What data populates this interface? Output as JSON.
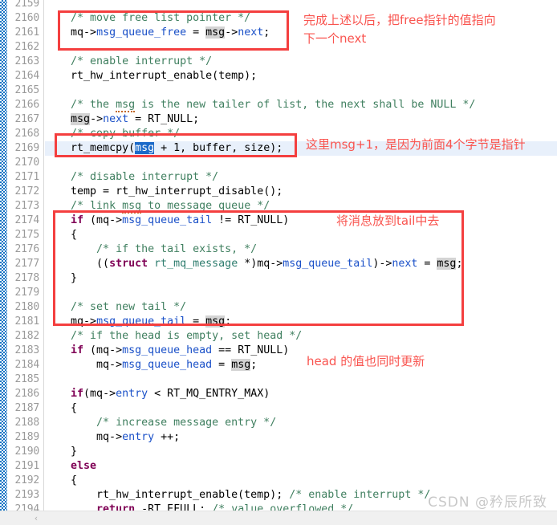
{
  "editor": {
    "first_visible_line": 2159,
    "line_height": 18,
    "highlighted_line": 2169,
    "gutter": {
      "line_numbers": [
        2159,
        2160,
        2161,
        2162,
        2163,
        2164,
        2165,
        2166,
        2167,
        2168,
        2169,
        2170,
        2171,
        2172,
        2173,
        2174,
        2175,
        2176,
        2177,
        2178,
        2179,
        2180,
        2181,
        2182,
        2183,
        2184,
        2185,
        2186,
        2187,
        2188,
        2189,
        2190,
        2191,
        2192,
        2193,
        2194
      ]
    },
    "code_lines": [
      {
        "n": 2159,
        "text": ""
      },
      {
        "n": 2160,
        "text": "    /* move free list pointer */"
      },
      {
        "n": 2161,
        "text": "    mq->msg_queue_free = msg->next;"
      },
      {
        "n": 2162,
        "text": ""
      },
      {
        "n": 2163,
        "text": "    /* enable interrupt */"
      },
      {
        "n": 2164,
        "text": "    rt_hw_interrupt_enable(temp);"
      },
      {
        "n": 2165,
        "text": ""
      },
      {
        "n": 2166,
        "text": "    /* the msg is the new tailer of list, the next shall be NULL */"
      },
      {
        "n": 2167,
        "text": "    msg->next = RT_NULL;"
      },
      {
        "n": 2168,
        "text": "    /* copy buffer */"
      },
      {
        "n": 2169,
        "text": "    rt_memcpy(msg + 1, buffer, size);"
      },
      {
        "n": 2170,
        "text": ""
      },
      {
        "n": 2171,
        "text": "    /* disable interrupt */"
      },
      {
        "n": 2172,
        "text": "    temp = rt_hw_interrupt_disable();"
      },
      {
        "n": 2173,
        "text": "    /* link msg to message queue */"
      },
      {
        "n": 2174,
        "text": "    if (mq->msg_queue_tail != RT_NULL)"
      },
      {
        "n": 2175,
        "text": "    {"
      },
      {
        "n": 2176,
        "text": "        /* if the tail exists, */"
      },
      {
        "n": 2177,
        "text": "        ((struct rt_mq_message *)mq->msg_queue_tail)->next = msg;"
      },
      {
        "n": 2178,
        "text": "    }"
      },
      {
        "n": 2179,
        "text": ""
      },
      {
        "n": 2180,
        "text": "    /* set new tail */"
      },
      {
        "n": 2181,
        "text": "    mq->msg_queue_tail = msg;"
      },
      {
        "n": 2182,
        "text": "    /* if the head is empty, set head */"
      },
      {
        "n": 2183,
        "text": "    if (mq->msg_queue_head == RT_NULL)"
      },
      {
        "n": 2184,
        "text": "        mq->msg_queue_head = msg;"
      },
      {
        "n": 2185,
        "text": ""
      },
      {
        "n": 2186,
        "text": "    if(mq->entry < RT_MQ_ENTRY_MAX)"
      },
      {
        "n": 2187,
        "text": "    {"
      },
      {
        "n": 2188,
        "text": "        /* increase message entry */"
      },
      {
        "n": 2189,
        "text": "        mq->entry ++;"
      },
      {
        "n": 2190,
        "text": "    }"
      },
      {
        "n": 2191,
        "text": "    else"
      },
      {
        "n": 2192,
        "text": "    {"
      },
      {
        "n": 2193,
        "text": "        rt_hw_interrupt_enable(temp); /* enable interrupt */"
      },
      {
        "n": 2194,
        "text": "        return -RT_EFULL; /* value overflowed */"
      }
    ]
  },
  "annotations": {
    "box1_note_line1": "完成上述以后，把free指针的值指向",
    "box1_note_line2": "下一个next",
    "box2_note": "这里msg+1，是因为前面4个字节是指针",
    "box3_note": "将消息放到tail中去",
    "head_note": "head 的值也同时更新"
  },
  "scrollbar": {
    "left_arrow_glyph": "‹"
  },
  "watermark": {
    "text": "CSDN @矜辰所致"
  },
  "colors": {
    "annotation_red": "#f9544f",
    "box_red": "#f43f3f",
    "comment_green": "#3f7f5f",
    "keyword_purple": "#7f0055",
    "member_blue": "#1a50c8",
    "highlight_line_blue": "#e8f0fb",
    "selection_blue": "#1b6ac9",
    "match_grey": "#d4d4d4",
    "lineno_grey": "#9a9a9a",
    "change_margin_blue": "#1273c4"
  }
}
